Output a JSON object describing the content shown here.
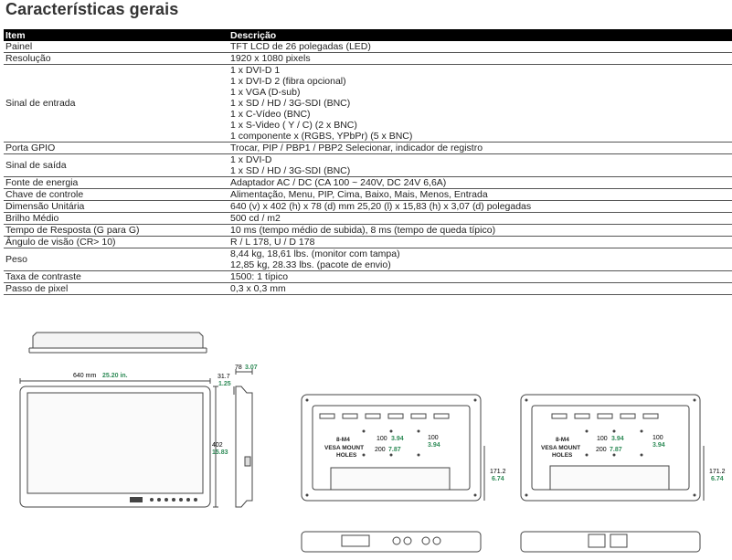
{
  "page_title": "Características gerais",
  "table": {
    "headers": {
      "item": "Item",
      "description": "Descrição"
    },
    "rows": [
      {
        "item": "Painel",
        "desc": [
          "TFT LCD de 26 polegadas (LED)"
        ]
      },
      {
        "item": "Resolução",
        "desc": [
          "1920 x 1080 pixels"
        ]
      },
      {
        "item": "Sinal de entrada",
        "desc": [
          "1 x DVI-D 1",
          "1 x DVI-D 2 (fibra opcional)",
          "1 x VGA (D-sub)",
          "1 x SD / HD / 3G-SDI (BNC)",
          "1 x C-Vídeo (BNC)",
          "1 x S-Video ( Y / C) (2 x BNC)",
          "1 componente x (RGBS, YPbPr) (5 x BNC)"
        ]
      },
      {
        "item": "Porta GPIO",
        "desc": [
          "Trocar, PIP / PBP1 / PBP2 Selecionar, indicador de registro"
        ]
      },
      {
        "item": "Sinal de saída",
        "desc": [
          "1 x DVI-D",
          "1 x SD / HD / 3G-SDI (BNC)"
        ]
      },
      {
        "item": "Fonte de energia",
        "desc": [
          "Adaptador AC / DC (CA 100 ~ 240V, DC 24V 6,6A)"
        ]
      },
      {
        "item": "Chave de controle",
        "desc": [
          "Alimentação, Menu, PIP, Cima, Baixo, Mais, Menos, Entrada"
        ]
      },
      {
        "item": "Dimensão Unitária",
        "desc": [
          "640 (v) x 402 (h) x 78 (d) mm 25,20 (l) x 15,83 (h) x 3,07 (d) polegadas"
        ]
      },
      {
        "item": "Brilho Médio",
        "desc": [
          "500 cd / m2"
        ]
      },
      {
        "item": "Tempo de Resposta (G para G)",
        "desc": [
          "10 ms (tempo médio de subida), 8 ms (tempo de queda típico)"
        ]
      },
      {
        "item": "Ângulo de visão (CR> 10)",
        "desc": [
          "R / L 178, U / D 178"
        ]
      },
      {
        "item": "Peso",
        "desc": [
          "8,44 kg, 18,61 lbs. (monitor com tampa)",
          "12,85 kg, 28.33 lbs. (pacote de envio)"
        ]
      },
      {
        "item": "Taxa de contraste",
        "desc": [
          "1500: 1 típico"
        ]
      },
      {
        "item": "Passo de pixel",
        "desc": [
          "0,3 x 0,3 mm"
        ]
      }
    ]
  },
  "drawings": {
    "front": {
      "width_mm": "640 mm",
      "width_in": "25.20 in.",
      "height_mm": "402",
      "height_in": "15.83",
      "side_mm": "31.7",
      "side_in": "1.25"
    },
    "side": {
      "depth_mm": "78",
      "depth_in": "3.07"
    },
    "rear_left": {
      "vesa_label": "8-M4",
      "vesa_label2": "VESA MOUNT",
      "vesa_label3": "HOLES",
      "h100_mm": "100",
      "h100_in": "3.94",
      "v100_mm": "100",
      "v100_in": "3.94",
      "h200_mm": "200",
      "h200_in": "7.87",
      "side_mm": "171.2",
      "side_in": "6.74"
    },
    "rear_right": {
      "vesa_label": "8-M4",
      "vesa_label2": "VESA MOUNT",
      "vesa_label3": "HOLES",
      "h100_mm": "100",
      "h100_in": "3.94",
      "v100_mm": "100",
      "v100_in": "3.94",
      "h200_mm": "200",
      "h200_in": "7.87",
      "side_mm": "171.2",
      "side_in": "6.74"
    },
    "colors": {
      "line": "#444444",
      "dimension_green": "#2e8b57"
    }
  }
}
